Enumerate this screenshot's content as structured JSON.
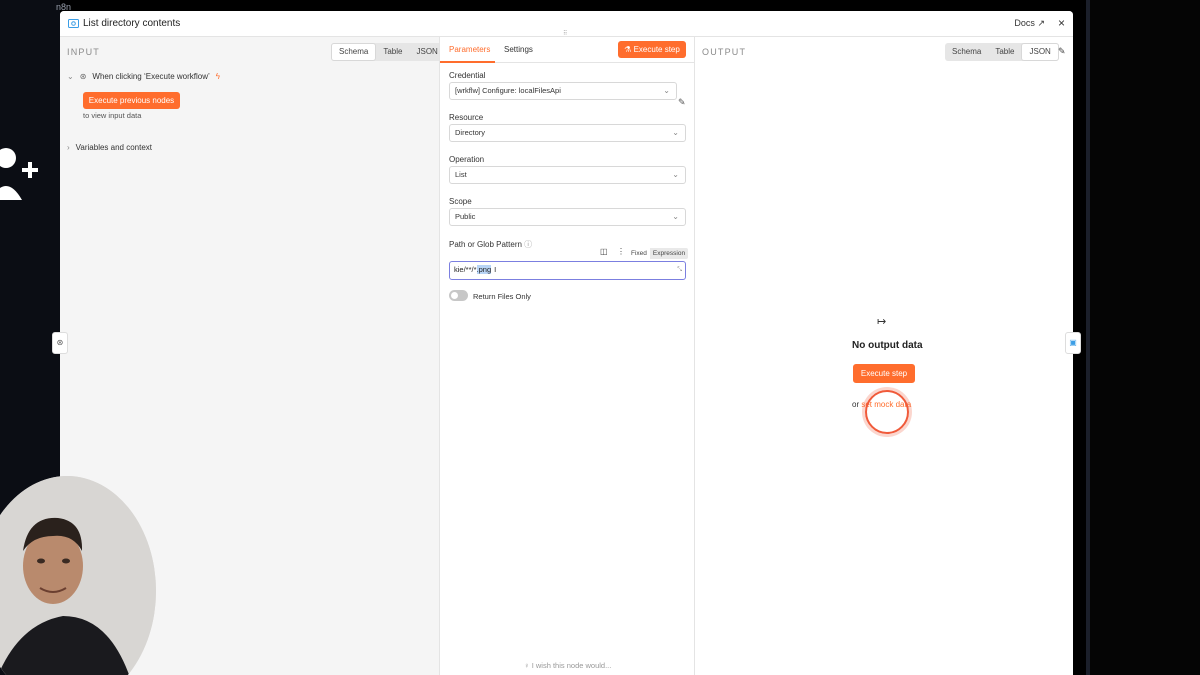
{
  "background": {
    "app_name": "n8n"
  },
  "modal": {
    "title": "List directory contents",
    "docs_label": "Docs",
    "close_label": "×"
  },
  "input": {
    "label": "INPUT",
    "view_tabs": [
      "Schema",
      "Table",
      "JSON"
    ],
    "active_view": "Schema",
    "trigger_node": "When clicking ‘Execute workflow’",
    "execute_prev_label": "Execute previous nodes",
    "view_hint": "to view input data",
    "variables_label": "Variables and context"
  },
  "params": {
    "tabs": [
      "Parameters",
      "Settings"
    ],
    "active_tab": "Parameters",
    "execute_label": "Execute step",
    "credential_label": "Credential",
    "credential_value": "[wrkflw] Configure: localFilesApi",
    "resource_label": "Resource",
    "resource_value": "Directory",
    "operation_label": "Operation",
    "operation_value": "List",
    "scope_label": "Scope",
    "scope_value": "Public",
    "path_label": "Path or Glob Pattern",
    "path_value_prefix": "kie/**/*",
    "path_value_selected": ".png",
    "mode_fixed": "Fixed",
    "mode_expression": "Expression",
    "return_files_label": "Return Files Only",
    "return_files_on": false,
    "wish_text": "I wish this node would..."
  },
  "output": {
    "label": "OUTPUT",
    "view_tabs": [
      "Schema",
      "Table",
      "JSON"
    ],
    "active_view": "JSON",
    "no_output": "No output data",
    "execute_label": "Execute step",
    "or_text": "or",
    "mock_link": "set mock data"
  },
  "colors": {
    "accent": "#ff6d2d",
    "focus": "#7b7fe0"
  }
}
